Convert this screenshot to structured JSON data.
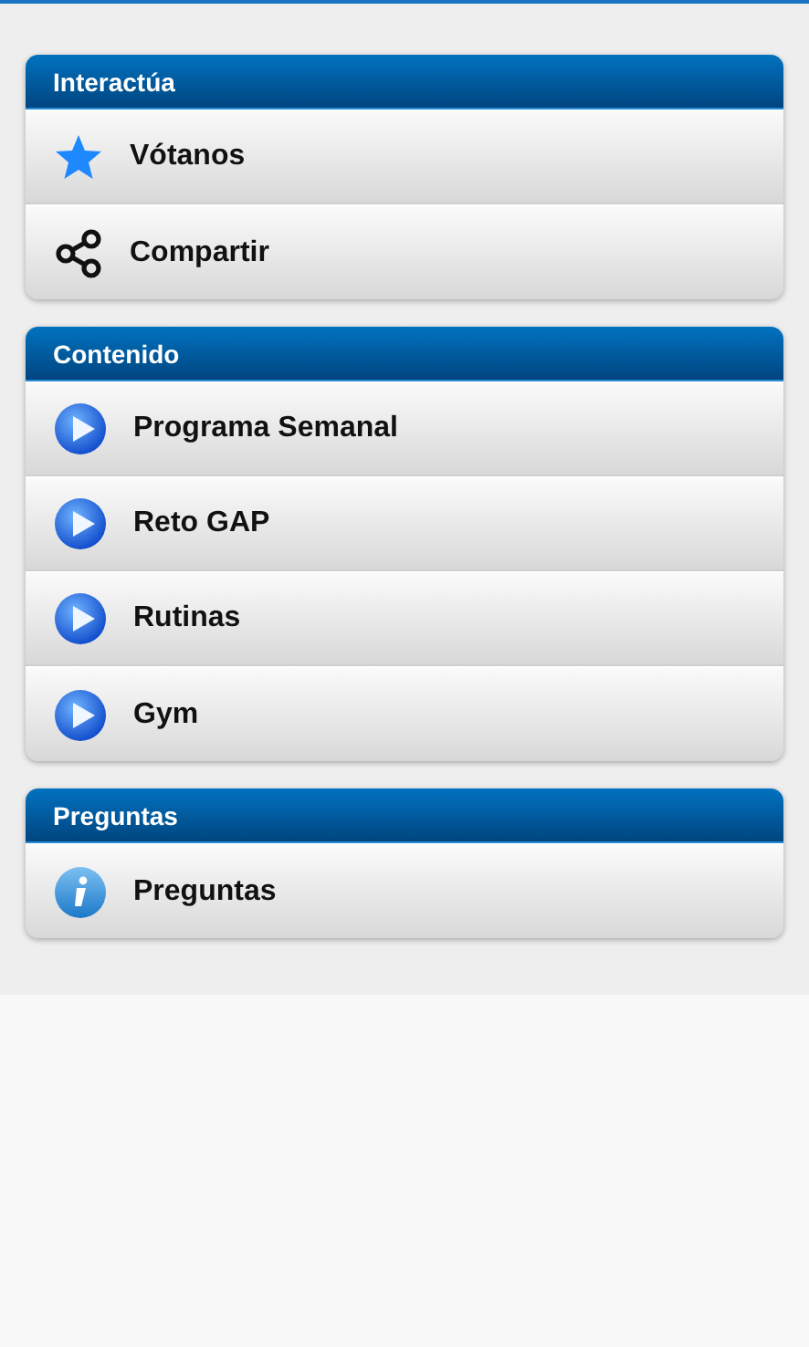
{
  "sections": [
    {
      "title": "Interactúa",
      "items": [
        {
          "label": "Vótanos",
          "kind": "star"
        },
        {
          "label": "Compartir",
          "kind": "share"
        }
      ]
    },
    {
      "title": "Contenido",
      "items": [
        {
          "label": "Programa Semanal",
          "kind": "play"
        },
        {
          "label": "Reto GAP",
          "kind": "play"
        },
        {
          "label": "Rutinas",
          "kind": "play"
        },
        {
          "label": "Gym",
          "kind": "play"
        }
      ]
    },
    {
      "title": "Preguntas",
      "items": [
        {
          "label": "Preguntas",
          "kind": "info"
        }
      ]
    }
  ]
}
